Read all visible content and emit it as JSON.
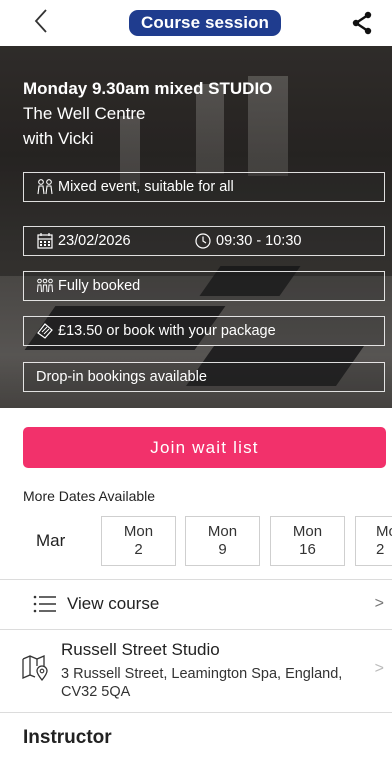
{
  "header": {
    "title": "Course session",
    "back_icon": "chevron-left-icon",
    "share_icon": "share-icon"
  },
  "session": {
    "title": "Monday 9.30am mixed STUDIO",
    "venue": "The Well Centre",
    "with": "with Vicki",
    "event_type": "Mixed event, suitable for all",
    "date": "23/02/2026",
    "time": "09:30 - 10:30",
    "availability": "Fully booked",
    "price": "£13.50 or book with your package",
    "dropin": "Drop-in bookings available"
  },
  "join_label": "Join wait list",
  "more_dates": {
    "label": "More Dates Available",
    "month": "Mar",
    "dates": [
      {
        "day": "Mon",
        "num": "2"
      },
      {
        "day": "Mon",
        "num": "9"
      },
      {
        "day": "Mon",
        "num": "16"
      },
      {
        "day": "Mo",
        "num": "2"
      }
    ]
  },
  "view_course": {
    "label": "View course",
    "chevron": ">"
  },
  "location": {
    "name": "Russell Street Studio",
    "address": "3 Russell Street, Leamington Spa, England, CV32 5QA",
    "chevron": ">"
  },
  "instructor_heading": "Instructor",
  "colors": {
    "header_pill": "#1f3c8e",
    "join_button": "#f2316b"
  }
}
